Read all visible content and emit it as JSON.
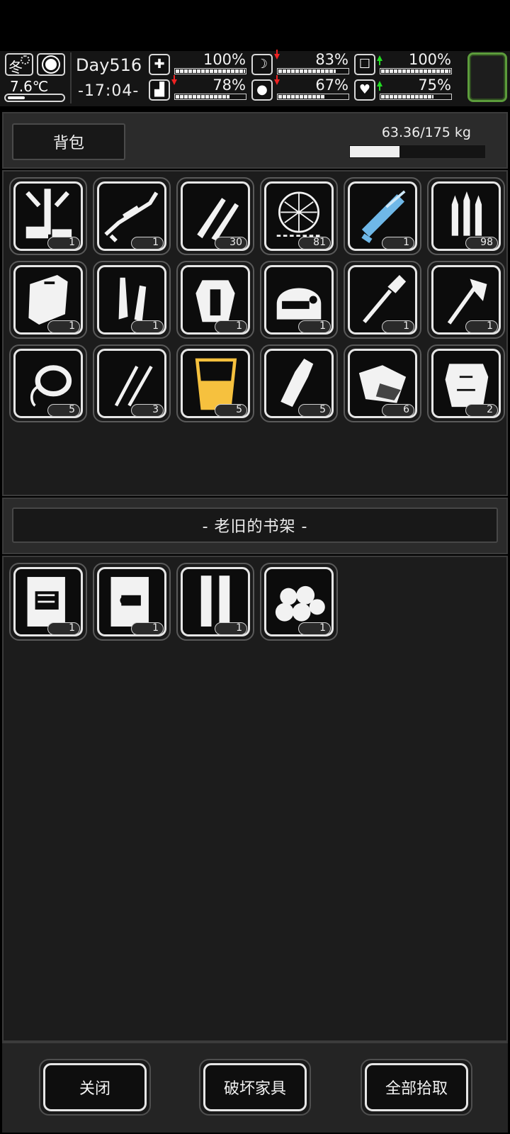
{
  "status": {
    "season": "冬",
    "temperature": "7.6℃",
    "day": "Day516",
    "time": "-17:04-",
    "stats": [
      {
        "id": "health",
        "icon": "medkit-icon",
        "percent": "100%",
        "fill": 1.0,
        "trend": "none"
      },
      {
        "id": "hunger",
        "icon": "stomach-icon",
        "percent": "83%",
        "fill": 0.83,
        "trend": "down"
      },
      {
        "id": "mental",
        "icon": "brain-icon",
        "percent": "100%",
        "fill": 1.0,
        "trend": "up"
      },
      {
        "id": "stamina",
        "icon": "boot-icon",
        "percent": "78%",
        "fill": 0.78,
        "trend": "down"
      },
      {
        "id": "thirst",
        "icon": "water-drop-icon",
        "percent": "67%",
        "fill": 0.67,
        "trend": "down"
      },
      {
        "id": "mood",
        "icon": "heart-icon",
        "percent": "75%",
        "fill": 0.75,
        "trend": "up"
      }
    ],
    "colors": {
      "trend_down": "#e22222",
      "trend_up": "#22dd22",
      "slot_border": "#5c9c3c"
    }
  },
  "backpack": {
    "tab_label": "背包",
    "weight_text": "63.36/175 kg",
    "weight_fill": 0.362,
    "items": [
      {
        "icon": "tripod-frame-icon",
        "count": "1"
      },
      {
        "icon": "sniper-rifle-icon",
        "count": "1"
      },
      {
        "icon": "rifle-bullets-icon",
        "count": "30"
      },
      {
        "icon": "wire-net-icon",
        "count": "81"
      },
      {
        "icon": "minigun-icon",
        "count": "1"
      },
      {
        "icon": "bullets-icon",
        "count": "98"
      },
      {
        "icon": "riot-shield-icon",
        "count": "1"
      },
      {
        "icon": "leg-armor-icon",
        "count": "1"
      },
      {
        "icon": "body-armor-icon",
        "count": "1"
      },
      {
        "icon": "helmet-icon",
        "count": "1"
      },
      {
        "icon": "shovel-icon",
        "count": "1"
      },
      {
        "icon": "axe-icon",
        "count": "1"
      },
      {
        "icon": "rope-icon",
        "count": "5"
      },
      {
        "icon": "lockpicks-icon",
        "count": "3"
      },
      {
        "icon": "juice-glass-icon",
        "count": "5"
      },
      {
        "icon": "bottle-icon",
        "count": "5"
      },
      {
        "icon": "raw-meat-icon",
        "count": "6"
      },
      {
        "icon": "ragged-cloth-icon",
        "count": "2"
      }
    ]
  },
  "container": {
    "title": "- 老旧的书架 -",
    "items": [
      {
        "icon": "engine-blueprint-icon",
        "count": "1"
      },
      {
        "icon": "part-blueprint-icon",
        "count": "1"
      },
      {
        "icon": "shell-casings-icon",
        "count": "1"
      },
      {
        "icon": "cotton-balls-icon",
        "count": "1"
      }
    ]
  },
  "footer": {
    "close_label": "关闭",
    "destroy_label": "破坏家具",
    "take_all_label": "全部拾取"
  }
}
